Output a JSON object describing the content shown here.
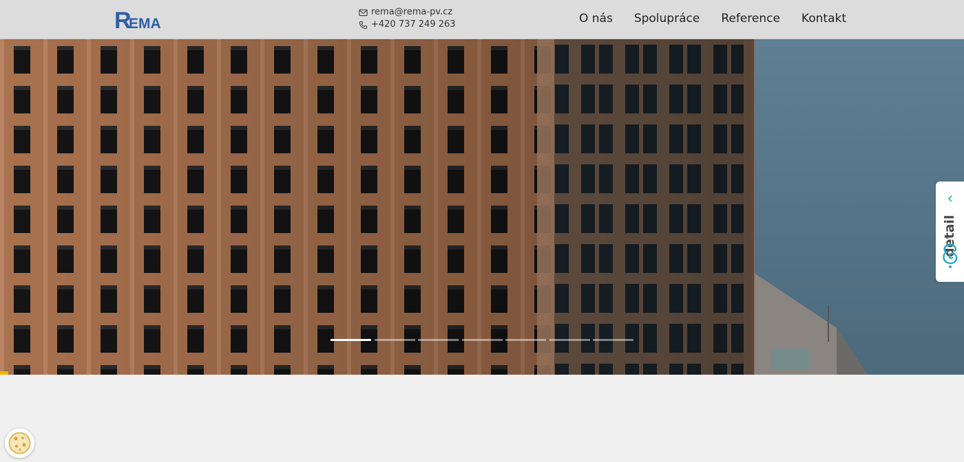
{
  "header": {
    "logo_text": "REMA",
    "contact": {
      "email": "rema@rema-pv.cz",
      "phone": "+420 737 249 263"
    },
    "nav": [
      {
        "label": "O nás"
      },
      {
        "label": "Spolupráce"
      },
      {
        "label": "Reference"
      },
      {
        "label": "Kontakt"
      }
    ]
  },
  "slider": {
    "slide_count": 7,
    "active_slide": 1
  },
  "side_widget": {
    "label": "detail"
  },
  "icons": {
    "email": "envelope-icon",
    "phone": "phone-icon",
    "side_widget_arrow": "chevron-left-icon",
    "side_widget_logo": "detail-swirl-icon",
    "cookie": "cookie-icon"
  },
  "colors": {
    "logo_blue": "#2e5fa8",
    "accent_yellow": "#f2b705",
    "widget_teal": "#2aa9c8"
  }
}
